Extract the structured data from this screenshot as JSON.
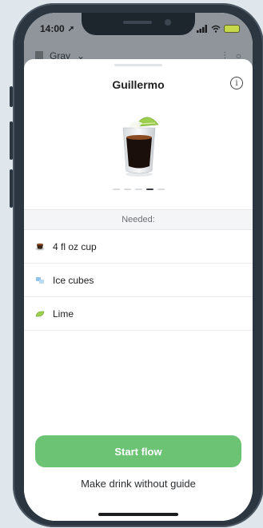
{
  "status_bar": {
    "time": "14:00",
    "location_glyph": "➚"
  },
  "background_app": {
    "store_name": "Gray",
    "chevron": "⌄"
  },
  "sheet": {
    "title": "Guillermo",
    "info_glyph": "i",
    "carousel": {
      "count": 5,
      "active_index": 3
    },
    "needed_label": "Needed:",
    "items": [
      {
        "label": "4 fl oz cup",
        "icon": "cup-icon"
      },
      {
        "label": "Ice cubes",
        "icon": "ice-cube-icon"
      },
      {
        "label": "Lime",
        "icon": "lime-icon"
      }
    ],
    "start_button": "Start flow",
    "guide_link": "Make drink without guide"
  },
  "colors": {
    "primary_green": "#6cc374",
    "battery": "#c7d84a"
  }
}
